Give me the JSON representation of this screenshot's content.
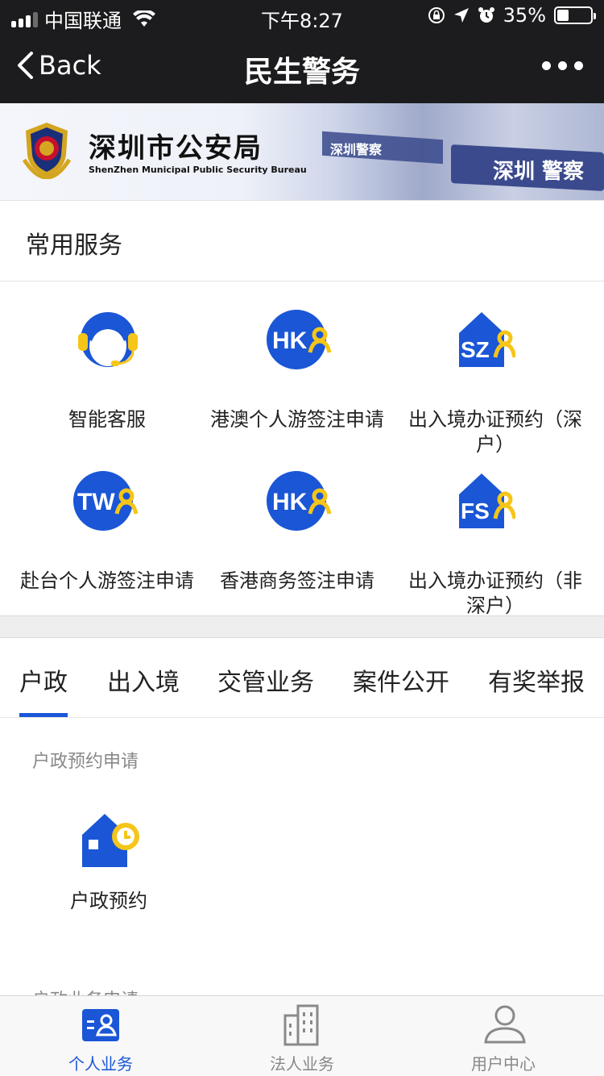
{
  "status_bar": {
    "carrier": "中国联通",
    "time": "下午8:27",
    "battery": "35%",
    "battery_level": 0.35
  },
  "nav": {
    "back_label": "Back",
    "title": "民生警务"
  },
  "banner": {
    "title_cn": "深圳市公安局",
    "title_en": "ShenZhen Municipal Public Security Bureau",
    "sign_a": "深圳警察",
    "sign_b": "深圳 警察"
  },
  "common_services": {
    "heading": "常用服务",
    "items": [
      {
        "label": "智能客服",
        "icon": "headset-agent-icon"
      },
      {
        "label": "港澳个人游签注申请",
        "icon": "hk-badge-icon",
        "badge": "HK"
      },
      {
        "label": "出入境办证预约（深户）",
        "icon": "sz-house-icon",
        "badge": "SZ"
      },
      {
        "label": "赴台个人游签注申请",
        "icon": "tw-badge-icon",
        "badge": "TW"
      },
      {
        "label": "香港商务签注申请",
        "icon": "hk-badge-icon",
        "badge": "HK"
      },
      {
        "label": "出入境办证预约（非深户）",
        "icon": "fs-house-icon",
        "badge": "FS"
      }
    ]
  },
  "category_tabs": [
    {
      "label": "户政",
      "active": true
    },
    {
      "label": "出入境",
      "active": false
    },
    {
      "label": "交管业务",
      "active": false
    },
    {
      "label": "案件公开",
      "active": false
    },
    {
      "label": "有奖举报",
      "active": false
    }
  ],
  "huzheng": {
    "subheading": "户政预约申请",
    "item_label": "户政预约",
    "next_subheading": "户政业务申请"
  },
  "bottom_tabs": [
    {
      "label": "个人业务",
      "icon": "personal-card-icon",
      "active": true
    },
    {
      "label": "法人业务",
      "icon": "building-icon",
      "active": false
    },
    {
      "label": "用户中心",
      "icon": "user-icon",
      "active": false
    }
  ],
  "colors": {
    "accent": "#1a56d6",
    "badge_yellow": "#f5c518",
    "nav_bg": "#1c1c1e"
  }
}
